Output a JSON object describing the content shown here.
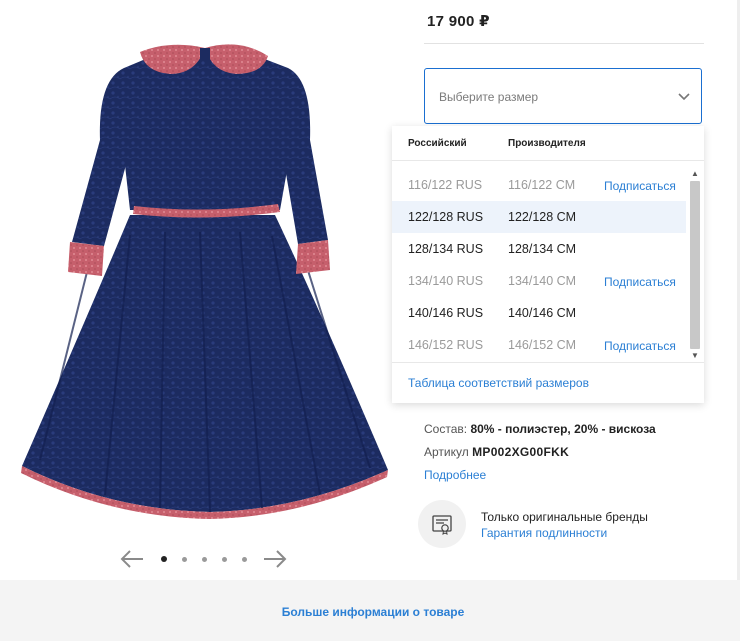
{
  "price": "17 900 ₽",
  "size_select": {
    "placeholder": "Выберите размер",
    "icon": "chevron-down-icon"
  },
  "size_dropdown": {
    "headers": {
      "russian": "Российский",
      "manufacturer": "Производителя"
    },
    "rows": [
      {
        "russian": "116/122 RUS",
        "manufacturer": "116/122 CM",
        "action": "Подписаться",
        "available": false,
        "highlighted": false
      },
      {
        "russian": "122/128 RUS",
        "manufacturer": "122/128 CM",
        "action": "",
        "available": true,
        "highlighted": true
      },
      {
        "russian": "128/134 RUS",
        "manufacturer": "128/134 CM",
        "action": "",
        "available": true,
        "highlighted": false
      },
      {
        "russian": "134/140 RUS",
        "manufacturer": "134/140 CM",
        "action": "Подписаться",
        "available": false,
        "highlighted": false
      },
      {
        "russian": "140/146 RUS",
        "manufacturer": "140/146 CM",
        "action": "",
        "available": true,
        "highlighted": false
      },
      {
        "russian": "146/152 RUS",
        "manufacturer": "146/152 CM",
        "action": "Подписаться",
        "available": false,
        "highlighted": false
      }
    ],
    "size_table_link": "Таблица соответствий размеров"
  },
  "composition": {
    "label": "Состав:",
    "value": "80% - полиэстер, 20% - вискоза"
  },
  "article": {
    "label": "Артикул",
    "value": "MP002XG00FKK"
  },
  "more_link": "Подробнее",
  "authenticity": {
    "text": "Только оригинальные бренды",
    "link": "Гарантия подлинности",
    "icon": "certificate-icon"
  },
  "carousel": {
    "count": 5,
    "active_index": 0,
    "prev_icon": "arrow-left-icon",
    "next_icon": "arrow-right-icon"
  },
  "bottom_link": "Больше информации о товаре",
  "colors": {
    "accent": "#2b7fd4",
    "select_border": "#1a6fd1",
    "dress": "#1b2a5e",
    "trim": "#c0606c",
    "highlight_row": "#edf3fb"
  }
}
